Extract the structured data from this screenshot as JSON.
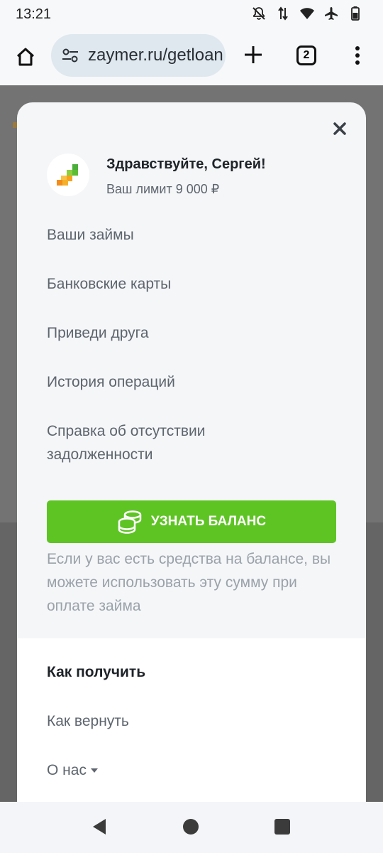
{
  "status": {
    "time": "13:21"
  },
  "browser": {
    "url": "zaymer.ru/getloan",
    "tab_count": "2"
  },
  "user": {
    "greeting": "Здравствуйте, Сергей!",
    "limit": "Ваш лимит 9 000 ₽"
  },
  "menu": {
    "items": [
      {
        "label": "Ваши займы"
      },
      {
        "label": "Банковские карты"
      },
      {
        "label": "Приведи друга"
      },
      {
        "label": "История операций"
      },
      {
        "label": "Справка об отсутствии задолженности"
      }
    ]
  },
  "balance": {
    "button_label": "УЗНАТЬ БАЛАНС",
    "note": "Если у вас есть средства на балансе, вы можете использовать эту сумму при оплате займа"
  },
  "info": {
    "items": [
      {
        "label": "Как получить"
      },
      {
        "label": "Как вернуть"
      },
      {
        "label": "О нас"
      }
    ]
  },
  "colors": {
    "accent_green": "#5ec424",
    "modal_bg": "#f5f6f8",
    "url_bg": "#dfe8ee"
  }
}
